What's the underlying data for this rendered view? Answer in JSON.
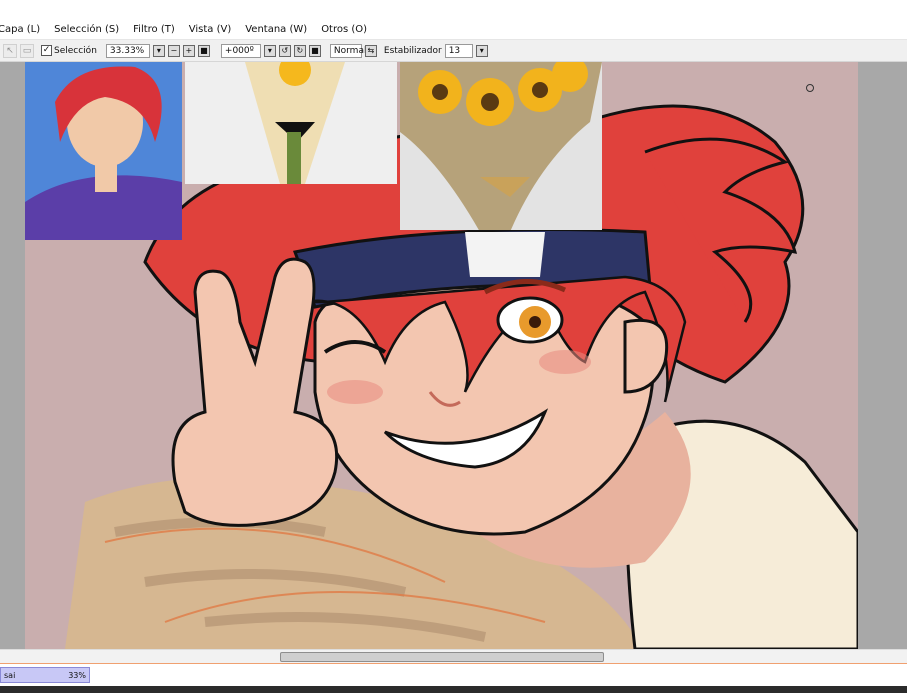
{
  "menu": [
    "Capa (L)",
    "Selección (S)",
    "Filtro (T)",
    "Vista (V)",
    "Ventana (W)",
    "Otros (O)"
  ],
  "toolbar": {
    "selection_label": "Selección",
    "zoom": "33.33%",
    "rotation": "+000º",
    "blend_mode": "Normal",
    "stabilizer_label": "Estabilizador",
    "stabilizer_value": "13"
  },
  "navigator": {
    "name": "sai",
    "zoom": "33%"
  },
  "colors": {
    "canvas_bg": "#c9aeae",
    "hair": "#e0413c",
    "headband": "#2d3566",
    "skin": "#f3c6b0",
    "shirt": "#f6ecd8",
    "bouquet": "#d8b98c"
  }
}
